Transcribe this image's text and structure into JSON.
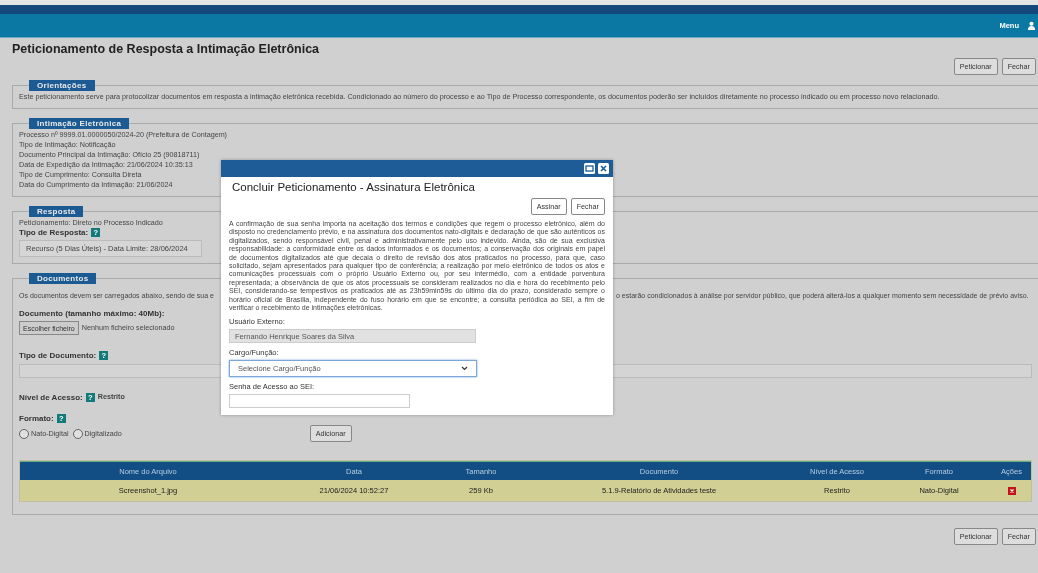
{
  "header": {
    "menu": "Menu"
  },
  "page": {
    "title": "Peticionamento de Resposta a Intimação Eletrônica",
    "buttons": [
      "Peticionar",
      "Fechar"
    ]
  },
  "orientacoes": {
    "legend": "Orientações",
    "text": "Este peticionamento serve para protocolizar documentos em resposta a intimação eletrônica recebida. Condicionado ao número do processo e ao Tipo de Processo correspondente, os documentos poderão ser incluídos diretamente no processo indicado ou em processo novo relacionado."
  },
  "intimacao": {
    "legend": "Intimação Eletrônica",
    "lines": [
      "Processo nº 9999.01.0000050/2024-20 (Prefeitura de Contagem)",
      "Tipo de Intimação: Notificação",
      "Documento Principal da Intimação: Ofício 25 (90818711)",
      "Data de Expedição da Intimação: 21/06/2024 10:35:13",
      "Tipo de Cumprimento: Consulta Direta",
      "Data do Cumprimento da Intimação: 21/06/2024"
    ]
  },
  "resposta": {
    "legend": "Resposta",
    "text": "Peticionamento: Direto no Processo Indicado",
    "label": "Tipo de Resposta:",
    "help": "?",
    "value": "Recurso (5 Dias Úteis) - Data Limite: 28/06/2024"
  },
  "documentos": {
    "legend": "Documentos",
    "notice_left": "Os documentos devem ser carregados abaixo, sendo de sua e",
    "notice_right": "o estarão condicionados à análise por servidor público, que poderá alterá-los a qualquer momento sem necessidade de prévio aviso.",
    "upload_label": "Documento (tamanho máximo: 40Mb):",
    "file_button": "Escolher ficheiro",
    "file_status": "Nenhum ficheiro selecionado",
    "tipo_label": "Tipo de Documento:",
    "tipo_help": "?",
    "nivel_label": "Nível de Acesso:",
    "nivel_help": "?",
    "nivel_value": "Restrito",
    "formato_label": "Formato:",
    "formato_help": "?",
    "formats": [
      {
        "label": "Nato-Digital",
        "selected": false
      },
      {
        "label": "Digitalizado",
        "selected": false
      }
    ],
    "add_button": "Adicionar",
    "table": {
      "columns": [
        "Nome do Arquivo",
        "Data",
        "Tamanho",
        "Documento",
        "Nível de Acesso",
        "Formato",
        "Ações"
      ],
      "rows": [
        {
          "cells": [
            "Screenshot_1.jpg",
            "21/06/2024 10:52:27",
            "259 Kb",
            "5.1.9-Relatório de Atividades teste",
            "Restrito",
            "Nato-Digital"
          ]
        }
      ]
    }
  },
  "footer_buttons": [
    "Peticionar",
    "Fechar"
  ],
  "dialog": {
    "title": "Concluir Peticionamento - Assinatura Eletrônica",
    "buttons": [
      "Assinar",
      "Fechar"
    ],
    "text": "A confirmação de sua senha importa na aceitação dos termos e condições que regem o processo eletrônico, além do disposto no credenciamento prévio, e na assinatura dos documentos nato-digitais e declaração de que são autênticos os digitalizados, sendo responsável civil, penal e administrativamente pelo uso indevido. Ainda, são de sua exclusiva responsabilidade: a conformidade entre os dados informados e os documentos; a conservação dos originais em papel de documentos digitalizados até que decaia o direito de revisão dos atos praticados no processo, para que, caso solicitado, sejam apresentados para qualquer tipo de conferência; a realização por meio eletrônico de todos os atos e comunicações processuais com o próprio Usuário Externo ou, por seu intermédio, com a entidade porventura representada; a observância de que os atos processuais se consideram realizados no dia e hora do recebimento pelo SEI, considerando-se tempestivos os praticados até as 23h59min59s do último dia do prazo, considerado sempre o horário oficial de Brasília, independente do fuso horário em que se encontre; a consulta periódica ao SEI, a fim de verificar o recebimento de intimações eletrônicas.",
    "user_label": "Usuário Externo:",
    "user_value": "Fernando Henrique Soares da Silva",
    "cargo_label": "Cargo/Função:",
    "cargo_placeholder": "Selecione Cargo/Função",
    "senha_label": "Senha de Acesso ao SEI:"
  }
}
